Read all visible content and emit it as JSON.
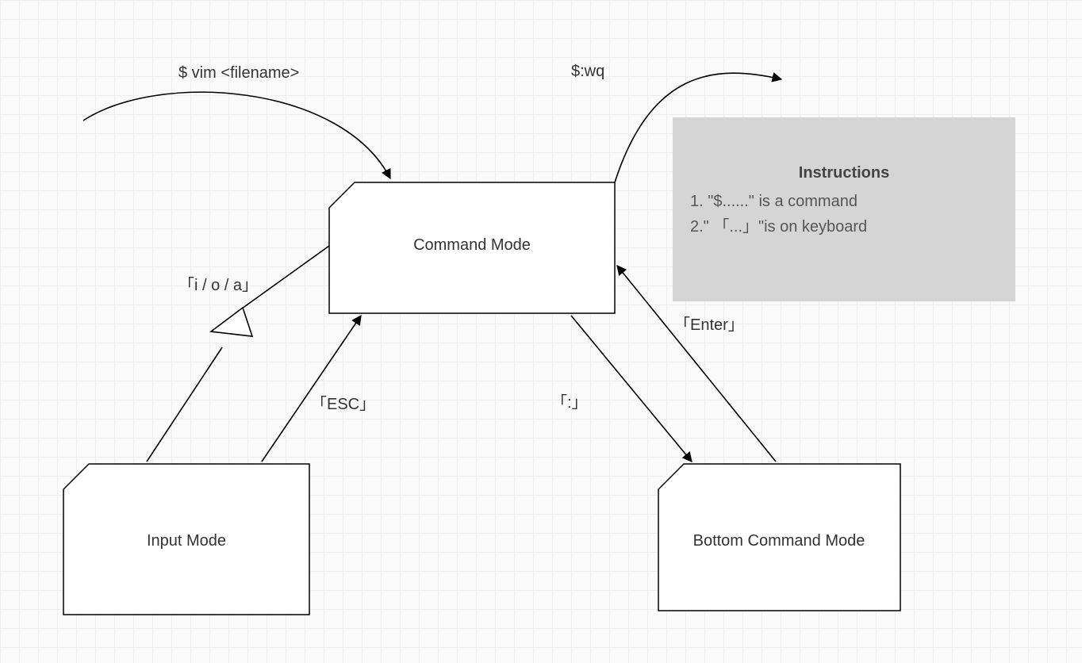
{
  "nodes": {
    "command": "Command Mode",
    "input": "Input Mode",
    "bottom": "Bottom Command Mode"
  },
  "edges": {
    "vim": "$ vim <filename>",
    "wq": "$:wq",
    "ioa": "「i / o / a」",
    "esc": "「ESC」",
    "colon": "「:」",
    "enter": "「Enter」"
  },
  "instructions": {
    "title": "Instructions",
    "line1": "1. \"$......\" is a command",
    "line2": "2.\" 「...」\"is on keyboard"
  }
}
